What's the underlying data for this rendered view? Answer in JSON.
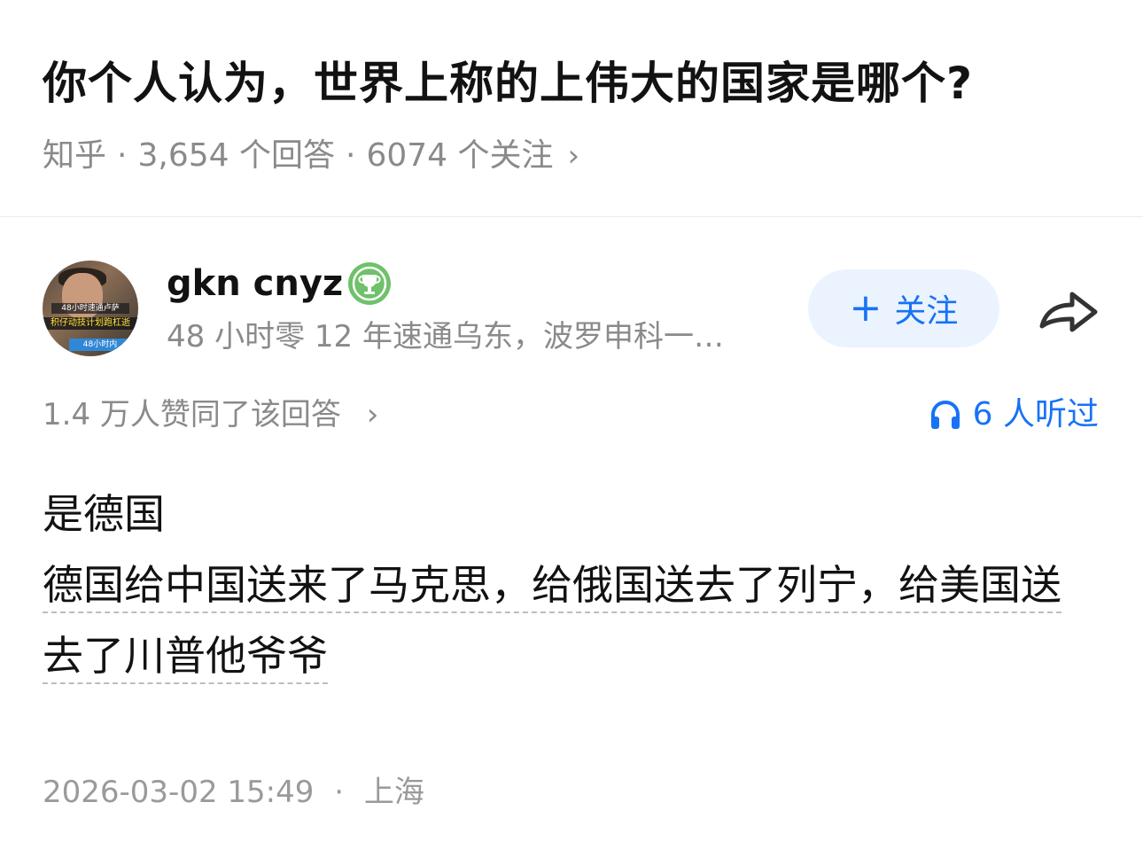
{
  "question": {
    "title": "你个人认为，世界上称的上伟大的国家是哪个?",
    "source": "知乎",
    "separator": "·",
    "answers_count": "3,654 个回答",
    "followers_count": "6074 个关注",
    "chevron": "›"
  },
  "author": {
    "name": "gkn cnyz",
    "bio": "48 小时零 12 年速通乌东，波罗申科一…",
    "avatar_captions": [
      "48小时速通卢萨",
      "积仔动技计划跑杠逝",
      "48小时内"
    ],
    "follow_button": {
      "plus": "+",
      "label": "关注"
    },
    "badge_color": "#6fc16a"
  },
  "stats": {
    "votes_text": "1.4 万人赞同了该回答",
    "chevron": "›",
    "listeners_text": "6 人听过"
  },
  "answer": {
    "first_line": "是德国",
    "underlined_text": "德国给中国送来了马克思，给俄国送去了列宁，给美国送去了川普他爷爷"
  },
  "footer": {
    "datetime": "2026-03-02 15:49",
    "separator": "·",
    "location": "上海"
  },
  "colors": {
    "accent": "#1772f6",
    "follow_bg": "#ebf3ff",
    "meta_gray": "#8a8a8a",
    "divider": "#ebebeb"
  },
  "icons": {
    "badge": "trophy-badge-icon",
    "share": "share-arrow-icon",
    "listen": "headphones-icon"
  }
}
